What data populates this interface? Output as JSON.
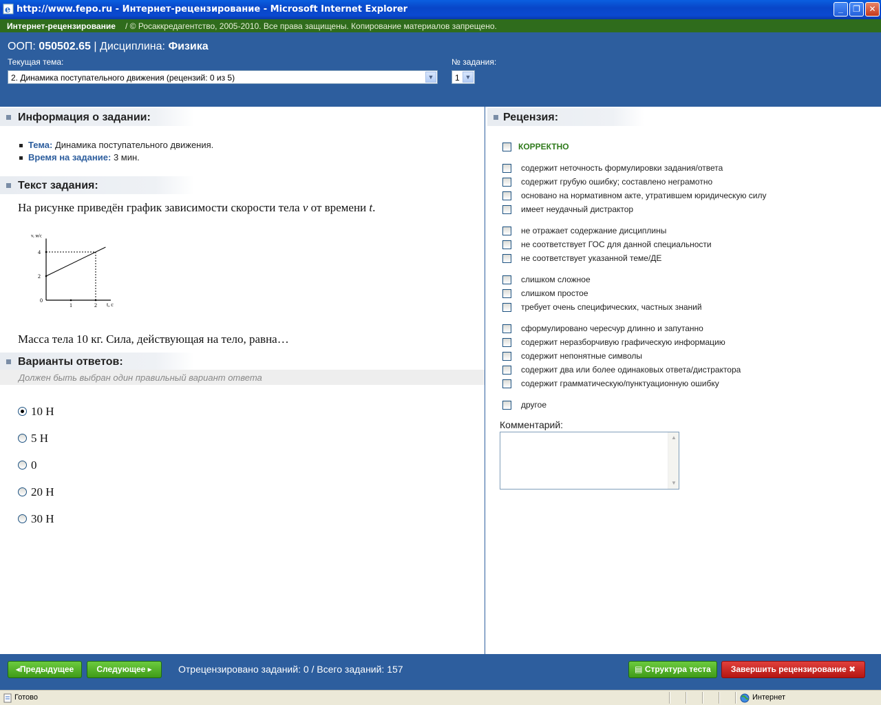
{
  "window": {
    "title": "http://www.fepo.ru - Интернет-рецензирование - Microsoft Internet Explorer",
    "minimize": "_",
    "maximize": "❐",
    "close": "✕"
  },
  "topbar": {
    "brand": "Интернет-рецензирование",
    "copyright": "/  © Росаккредагентство, 2005-2010. Все права защищены. Копирование материалов запрещено."
  },
  "header": {
    "oop_label": "ООП:",
    "oop_value": "050502.65",
    "discipline_sep": "| Дисциплина:",
    "discipline_value": "Физика",
    "topic_label": "Текущая тема:",
    "topic_value": "2. Динамика поступательного движения  (рецензий: 0 из 5)",
    "task_no_label": "№ задания:",
    "task_no_value": "1"
  },
  "info": {
    "heading": "Информация о задании:",
    "topic_key": "Тема:",
    "topic_val": "Динамика поступательного движения.",
    "time_key": "Время на задание:",
    "time_val": "3 мин."
  },
  "task": {
    "heading": "Текст задания:",
    "text1_a": "На рисунке приведён график зависимости скорости тела ",
    "text1_v": "v",
    "text1_b": " от времени ",
    "text1_t": "t",
    "text1_c": ".",
    "text2": "Масса тела 10 кг. Сила, действующая на тело, равна…"
  },
  "chart_data": {
    "type": "line",
    "xlabel": "t, c",
    "ylabel": "v, м/с",
    "x_ticks": [
      "0",
      "1",
      "2"
    ],
    "y_ticks": [
      "2",
      "4"
    ],
    "series": [
      {
        "x": [
          0,
          2.4
        ],
        "y": [
          2,
          4.4
        ]
      }
    ],
    "marker_point": {
      "x": 2,
      "y": 4
    },
    "xlim": [
      0,
      2.5
    ],
    "ylim": [
      0,
      5
    ]
  },
  "answers": {
    "heading": "Варианты ответов:",
    "hint": "Должен быть выбран один правильный вариант ответа",
    "options": [
      "10 Н",
      "5 Н",
      "0",
      "20 Н",
      "30 Н"
    ],
    "selected": 0
  },
  "review": {
    "heading": "Рецензия:",
    "correct": "КОРРЕКТНО",
    "groups": [
      [
        "содержит неточность формулировки задания/ответа",
        "содержит грубую ошибку; составлено неграмотно",
        "основано на нормативном акте, утратившем юридическую силу",
        "имеет неудачный дистрактор"
      ],
      [
        "не отражает содержание дисциплины",
        "не соответствует ГОС для данной специальности",
        "не соответствует указанной теме/ДЕ"
      ],
      [
        "слишком сложное",
        "слишком простое",
        "требует очень специфических, частных знаний"
      ],
      [
        "сформулировано чересчур длинно и запутанно",
        "содержит неразборчивую графическую информацию",
        "содержит непонятные символы",
        "содержит два или более одинаковых ответа/дистрактора",
        "содержит грамматическую/пунктуационную ошибку"
      ],
      [
        "другое"
      ]
    ],
    "comment_label": "Комментарий:"
  },
  "footer": {
    "prev": "Предыдущее",
    "next": "Следующее",
    "stat": "Отрецензировано заданий: 0 / Всего заданий:  157",
    "structure": "Структура теста",
    "finish": "Завершить рецензирование"
  },
  "status": {
    "text": "Готово",
    "zone": "Интернет"
  }
}
